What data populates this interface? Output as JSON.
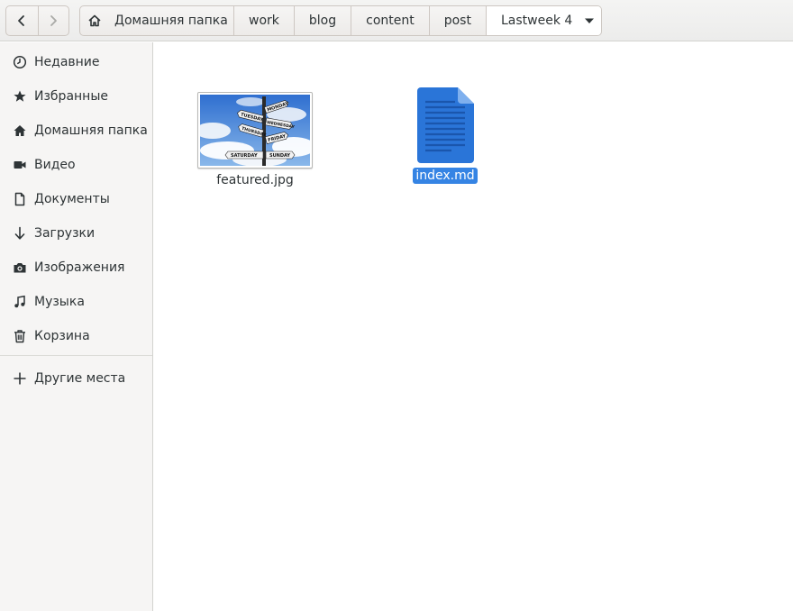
{
  "window": {
    "theme_colors": {
      "accent": "#3584e4",
      "doc_icon_blue": "#2a75d8",
      "text": "#2e3436",
      "sidebar_bg": "#f6f5f4"
    }
  },
  "navigation": {
    "back_icon": "chevron-left-icon",
    "forward_icon": "chevron-right-icon"
  },
  "pathbar": {
    "home_icon": "home-icon",
    "crumbs": [
      "Домашняя папка",
      "work",
      "blog",
      "content",
      "post",
      "Lastweek 4"
    ],
    "current_menu_icon": "triangle-down-icon"
  },
  "sidebar": {
    "items": [
      {
        "label": "Недавние",
        "icon": "clock-icon"
      },
      {
        "label": "Избранные",
        "icon": "star-icon"
      },
      {
        "label": "Домашняя папка",
        "icon": "home-icon"
      },
      {
        "label": "Видео",
        "icon": "video-icon"
      },
      {
        "label": "Документы",
        "icon": "document-icon"
      },
      {
        "label": "Загрузки",
        "icon": "download-arrow-icon"
      },
      {
        "label": "Изображения",
        "icon": "camera-icon"
      },
      {
        "label": "Музыка",
        "icon": "music-note-icon"
      },
      {
        "label": "Корзина",
        "icon": "trash-icon"
      }
    ],
    "other_places": {
      "label": "Другие места",
      "icon": "plus-icon"
    }
  },
  "files": [
    {
      "name": "featured.jpg",
      "type": "image-thumbnail",
      "selected": false,
      "sign_words": [
        "TUESDAY",
        "MONDAY",
        "WEDNESDAY",
        "THURSDAY",
        "FRIDAY",
        "SATURDAY",
        "SUNDAY"
      ]
    },
    {
      "name": "index.md",
      "type": "text-document-icon",
      "selected": true
    }
  ]
}
